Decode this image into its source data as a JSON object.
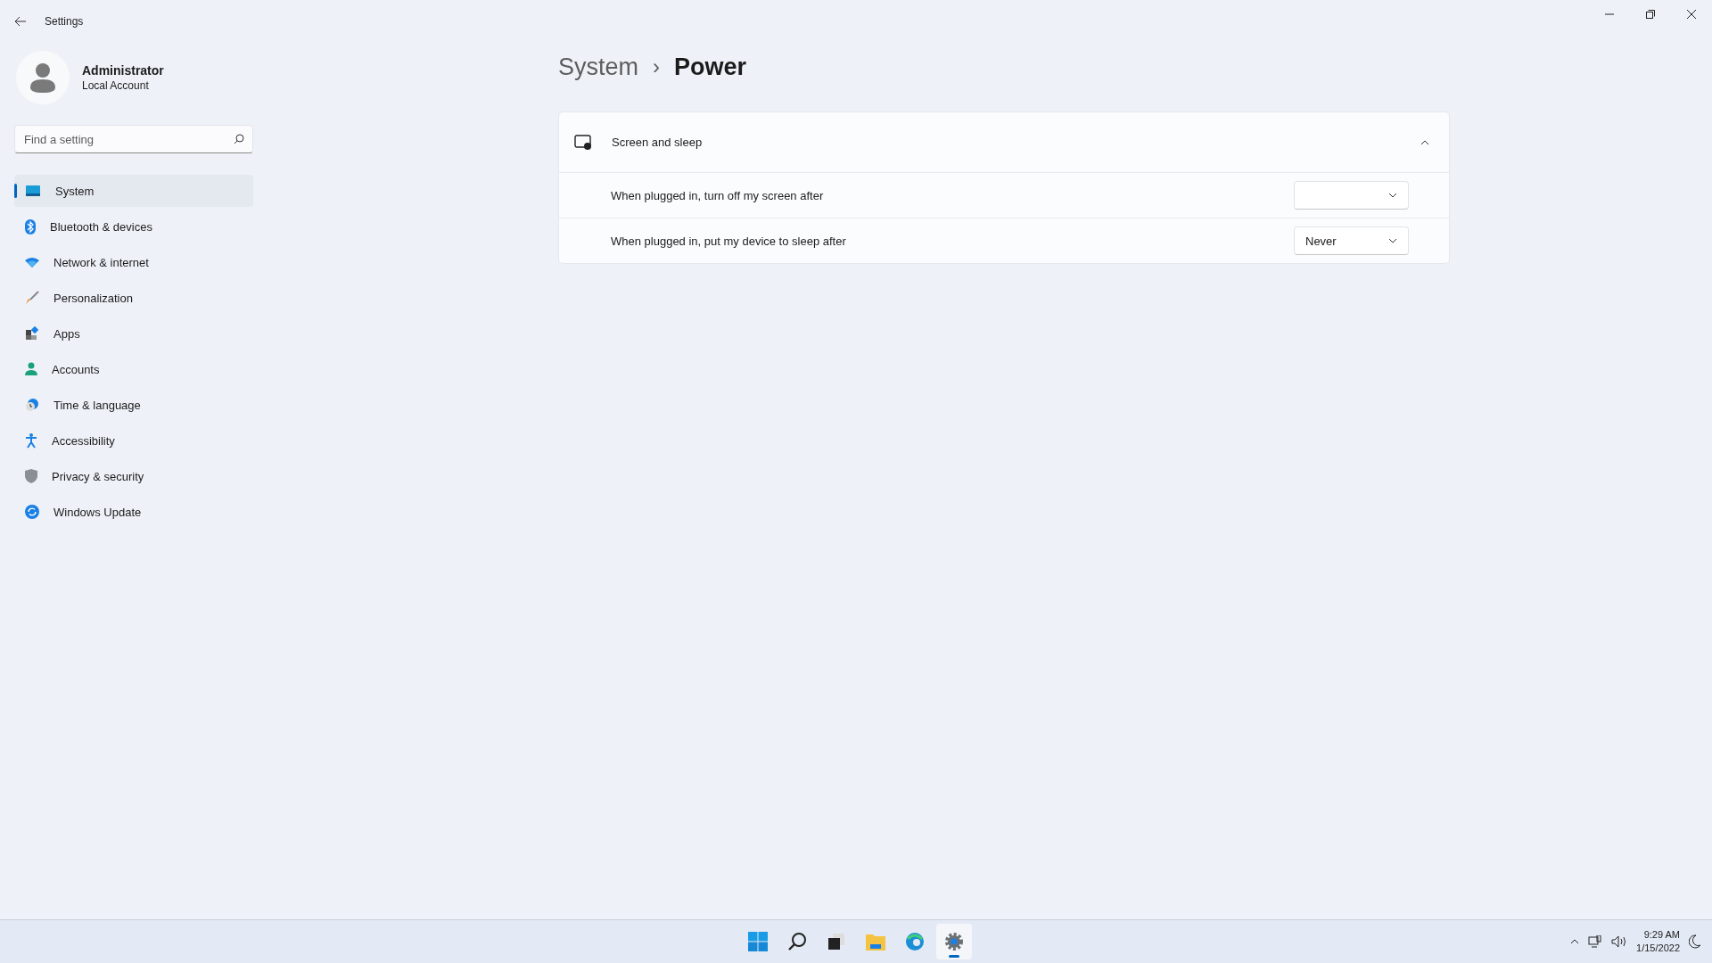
{
  "window": {
    "title": "Settings"
  },
  "account": {
    "name": "Administrator",
    "type": "Local Account"
  },
  "search": {
    "placeholder": "Find a setting"
  },
  "sidebar": {
    "items": [
      {
        "label": "System",
        "selected": true
      },
      {
        "label": "Bluetooth & devices",
        "selected": false
      },
      {
        "label": "Network & internet",
        "selected": false
      },
      {
        "label": "Personalization",
        "selected": false
      },
      {
        "label": "Apps",
        "selected": false
      },
      {
        "label": "Accounts",
        "selected": false
      },
      {
        "label": "Time & language",
        "selected": false
      },
      {
        "label": "Accessibility",
        "selected": false
      },
      {
        "label": "Privacy & security",
        "selected": false
      },
      {
        "label": "Windows Update",
        "selected": false
      }
    ]
  },
  "breadcrumb": {
    "parent": "System",
    "separator": "›",
    "current": "Power"
  },
  "section": {
    "title": "Screen and sleep",
    "expanded": true,
    "rows": [
      {
        "label": "When plugged in, turn off my screen after"
      },
      {
        "label": "When plugged in, put my device to sleep after",
        "value": "Never"
      }
    ]
  },
  "taskbar": {
    "apps": [
      {
        "selected": false
      },
      {
        "selected": false
      },
      {
        "selected": false
      },
      {
        "selected": false
      },
      {
        "selected": false
      },
      {
        "selected": true
      }
    ],
    "time": "9:29 AM",
    "date": "1/15/2022"
  }
}
